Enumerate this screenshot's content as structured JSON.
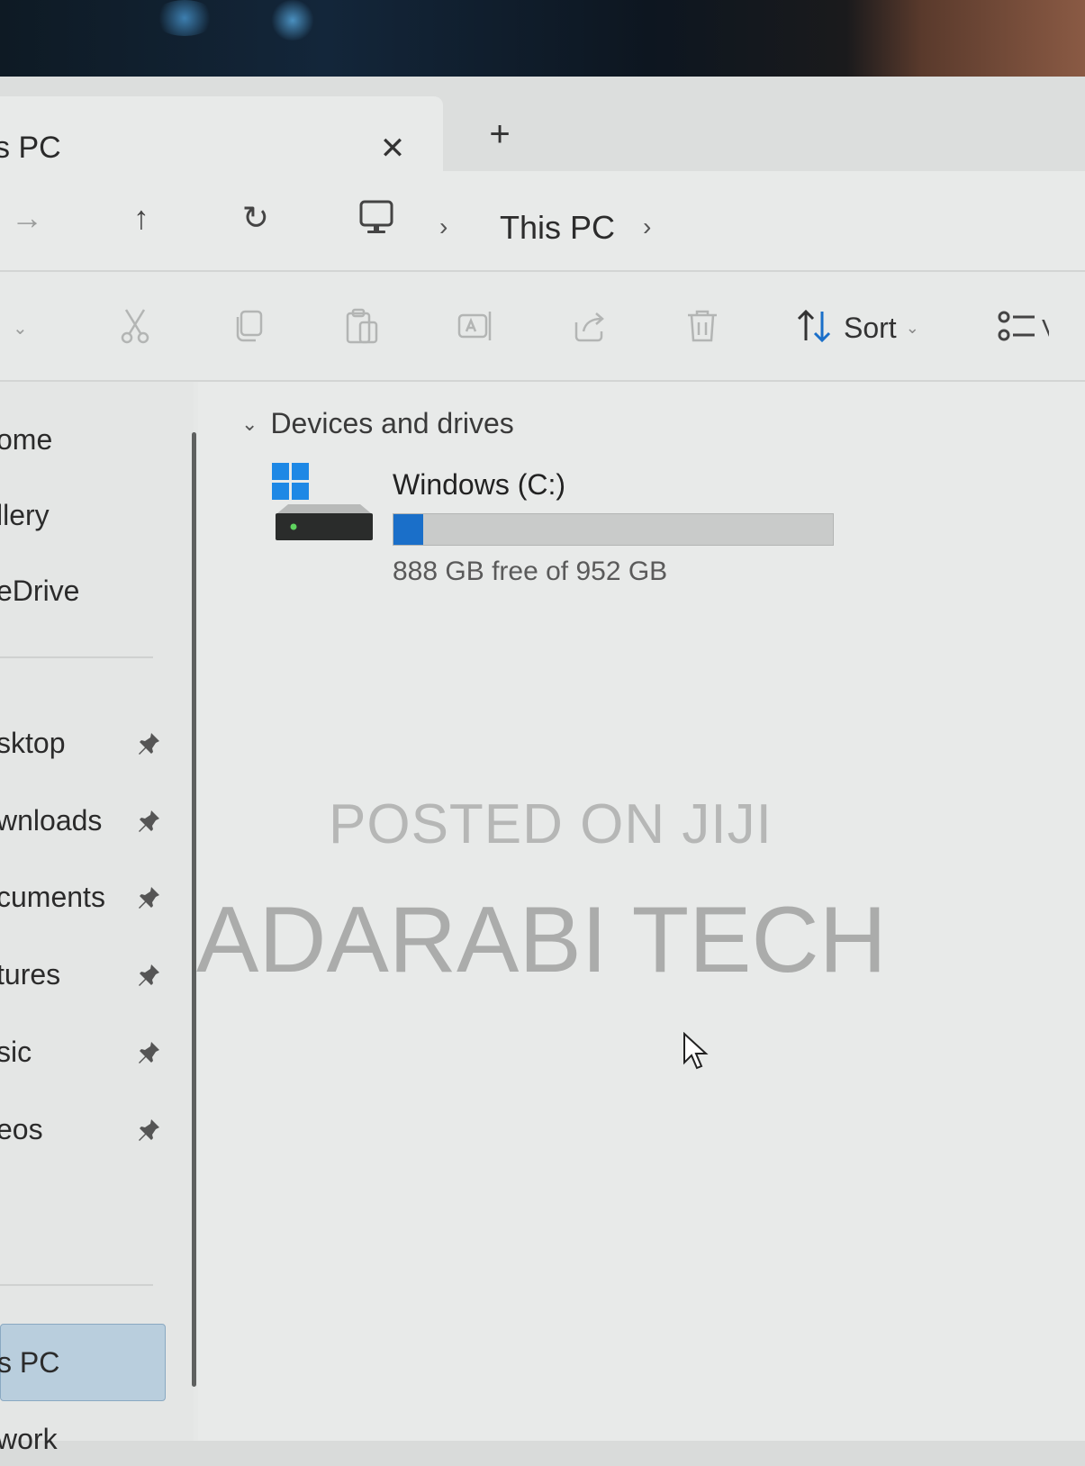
{
  "tab": {
    "title": "s PC",
    "close_glyph": "✕",
    "new_glyph": "+"
  },
  "navigation": {
    "forward_glyph": "→",
    "up_glyph": "↑",
    "refresh_glyph": "↻",
    "separator_glyph": "›",
    "breadcrumb": "This PC"
  },
  "command_bar": {
    "new_chevron": "⌄",
    "sort_label": "Sort",
    "sort_chevron": "⌄",
    "view_label": "V",
    "icons": [
      "cut-icon",
      "copy-icon",
      "paste-icon",
      "rename-icon",
      "share-icon",
      "delete-icon",
      "sort-icon",
      "view-icon"
    ]
  },
  "sidebar": {
    "top_items": [
      {
        "label": "ome"
      },
      {
        "label": "llery"
      },
      {
        "label": "eDrive"
      }
    ],
    "pinned_items": [
      {
        "label": "sktop"
      },
      {
        "label": "wnloads"
      },
      {
        "label": "cuments"
      },
      {
        "label": "tures"
      },
      {
        "label": "sic"
      },
      {
        "label": "eos"
      }
    ],
    "bottom_items": [
      {
        "label": "s PC",
        "selected": true
      },
      {
        "label": "work",
        "selected": false
      }
    ]
  },
  "main": {
    "group_label": "Devices and drives",
    "group_chevron": "⌄",
    "drives": [
      {
        "name": "Windows (C:)",
        "free_text": "888 GB free of 952 GB",
        "used_fraction": 0.0672
      }
    ]
  },
  "watermark": {
    "line1": "POSTED ON JIJI",
    "line2": "ADARABI TECH"
  },
  "colors": {
    "accent": "#1a6fc9",
    "selected_bg": "#b9cedd",
    "windows_logo": "#1e88e5"
  }
}
